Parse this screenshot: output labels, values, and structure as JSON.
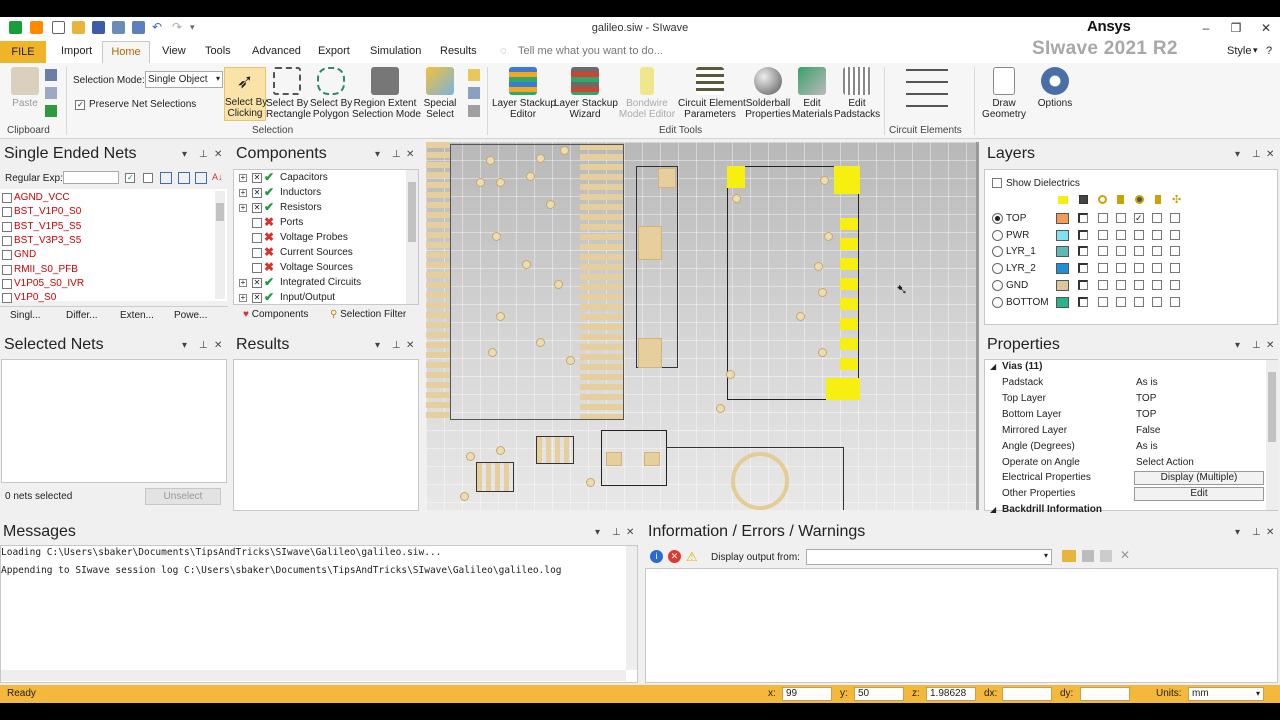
{
  "window": {
    "title": "galileo.siw - SIwave",
    "brand": "Ansys",
    "product": "SIwave 2021 R2"
  },
  "menu": {
    "file": "FILE",
    "tabs": [
      "Import",
      "Home",
      "View",
      "Tools",
      "Advanced",
      "Export",
      "Simulation",
      "Results"
    ],
    "tell_me": "Tell me what you want to do...",
    "style": "Style"
  },
  "ribbon": {
    "paste": "Paste",
    "clipboard_group": "Clipboard",
    "selection_mode_label": "Selection Mode:",
    "selection_mode_value": "Single Object",
    "preserve_net": "Preserve Net Selections",
    "selection_buttons": [
      "Select By\nClicking",
      "Select By\nRectangle",
      "Select By\nPolygon",
      "Region Extent\nSelection Mode",
      "Special\nSelect"
    ],
    "selection_group": "Selection",
    "edit_buttons": [
      "Layer Stackup\nEditor",
      "Layer Stackup\nWizard",
      "Bondwire\nModel Editor",
      "Circuit Element\nParameters",
      "Solderball\nProperties",
      "Edit\nMaterials",
      "Edit\nPadstacks"
    ],
    "edit_group": "Edit Tools",
    "circuit_group": "Circuit Elements",
    "draw_geometry": "Draw\nGeometry",
    "options": "Options"
  },
  "nets_panel": {
    "title": "Single Ended Nets",
    "regex_label": "Regular Exp:",
    "nets": [
      "AGND_VCC",
      "BST_V1P0_S0",
      "BST_V1P5_S5",
      "BST_V3P3_S5",
      "GND",
      "RMII_S0_PFB",
      "V1P05_S0_IVR",
      "V1P0_S0"
    ],
    "tabs": [
      "Singl...",
      "Differ...",
      "Exten...",
      "Powe..."
    ]
  },
  "components_panel": {
    "title": "Components",
    "items": [
      {
        "label": "Capacitors",
        "status": "check",
        "expand": true
      },
      {
        "label": "Inductors",
        "status": "check",
        "expand": true
      },
      {
        "label": "Resistors",
        "status": "check",
        "expand": true
      },
      {
        "label": "Ports",
        "status": "x",
        "expand": false
      },
      {
        "label": "Voltage Probes",
        "status": "x",
        "expand": false
      },
      {
        "label": "Current Sources",
        "status": "x",
        "expand": false
      },
      {
        "label": "Voltage Sources",
        "status": "x",
        "expand": false
      },
      {
        "label": "Integrated Circuits",
        "status": "check",
        "expand": true
      },
      {
        "label": "Input/Output",
        "status": "check",
        "expand": true
      }
    ],
    "tabs": [
      "Components",
      "Selection Filter"
    ]
  },
  "selected_nets": {
    "title": "Selected Nets",
    "count": "0 nets selected",
    "unselect": "Unselect"
  },
  "results": {
    "title": "Results"
  },
  "layers": {
    "title": "Layers",
    "show_dielectrics": "Show Dielectrics",
    "items": [
      {
        "name": "TOP",
        "color": "#f59b5a",
        "selected": true
      },
      {
        "name": "PWR",
        "color": "#7fe3ef",
        "selected": false
      },
      {
        "name": "LYR_1",
        "color": "#5fb8b4",
        "selected": false
      },
      {
        "name": "LYR_2",
        "color": "#1f8fd6",
        "selected": false
      },
      {
        "name": "GND",
        "color": "#d9c79b",
        "selected": false
      },
      {
        "name": "BOTTOM",
        "color": "#29b38a",
        "selected": false
      }
    ]
  },
  "properties": {
    "title": "Properties",
    "section": "Vias (11)",
    "rows": [
      {
        "key": "Padstack",
        "value": "As is"
      },
      {
        "key": "Top Layer",
        "value": "TOP"
      },
      {
        "key": "Bottom Layer",
        "value": "TOP"
      },
      {
        "key": "Mirrored Layer",
        "value": "False"
      },
      {
        "key": "Angle (Degrees)",
        "value": "As is"
      },
      {
        "key": "Operate on Angle",
        "value": "Select Action"
      },
      {
        "key": "Electrical Properties",
        "value": "Display (Multiple)"
      },
      {
        "key": "Other Properties",
        "value": "Edit"
      }
    ],
    "section2": "Backdrill Information"
  },
  "messages": {
    "title": "Messages",
    "lines": [
      "Loading C:\\Users\\sbaker\\Documents\\TipsAndTricks\\SIwave\\Galileo\\galileo.siw...",
      "Appending to SIwave session log C:\\Users\\sbaker\\Documents\\TipsAndTricks\\SIwave\\Galileo\\galileo.log"
    ]
  },
  "info": {
    "title": "Information / Errors / Warnings",
    "display_output": "Display output from:"
  },
  "status": {
    "ready": "Ready",
    "x_label": "x:",
    "x": "99",
    "y_label": "y:",
    "y": "50",
    "z_label": "z:",
    "z": "1.98628",
    "dx_label": "dx:",
    "dx": "",
    "dy_label": "dy:",
    "dy": "",
    "units_label": "Units:",
    "units": "mm"
  },
  "colors": {
    "accent": "#f0b429",
    "status_bar": "#f3b83c",
    "pcb_highlight": "#f7ef0f",
    "net_text": "#cc0000"
  }
}
